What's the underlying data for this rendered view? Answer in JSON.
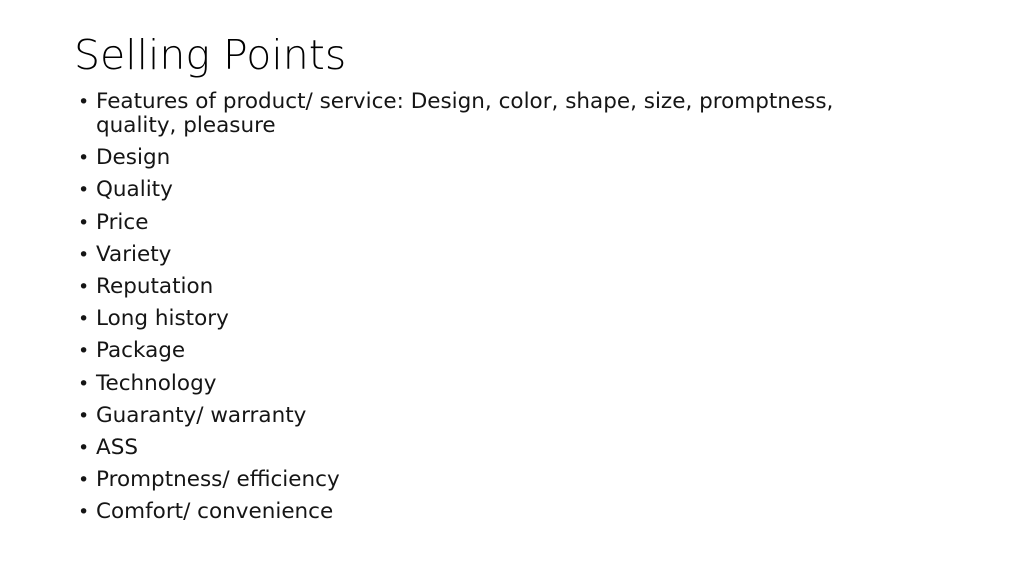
{
  "slide": {
    "title": "Selling Points",
    "background_color": "#ffffff",
    "text_color": "#151515",
    "bullet_glyph": "•",
    "bullets": [
      {
        "text": "Features of product/ service: Design, color, shape, size, promptness, quality, pleasure",
        "wraps": true
      },
      {
        "text": "Design",
        "wraps": false
      },
      {
        "text": "Quality",
        "wraps": false
      },
      {
        "text": "Price",
        "wraps": false
      },
      {
        "text": "Variety",
        "wraps": false
      },
      {
        "text": "Reputation",
        "wraps": false
      },
      {
        "text": "Long history",
        "wraps": false
      },
      {
        "text": "Package",
        "wraps": false
      },
      {
        "text": "Technology",
        "wraps": false
      },
      {
        "text": "Guaranty/ warranty",
        "wraps": false
      },
      {
        "text": "ASS",
        "wraps": false
      },
      {
        "text": "Promptness/ efficiency",
        "wraps": false
      },
      {
        "text": "Comfort/ convenience",
        "wraps": false
      }
    ]
  }
}
